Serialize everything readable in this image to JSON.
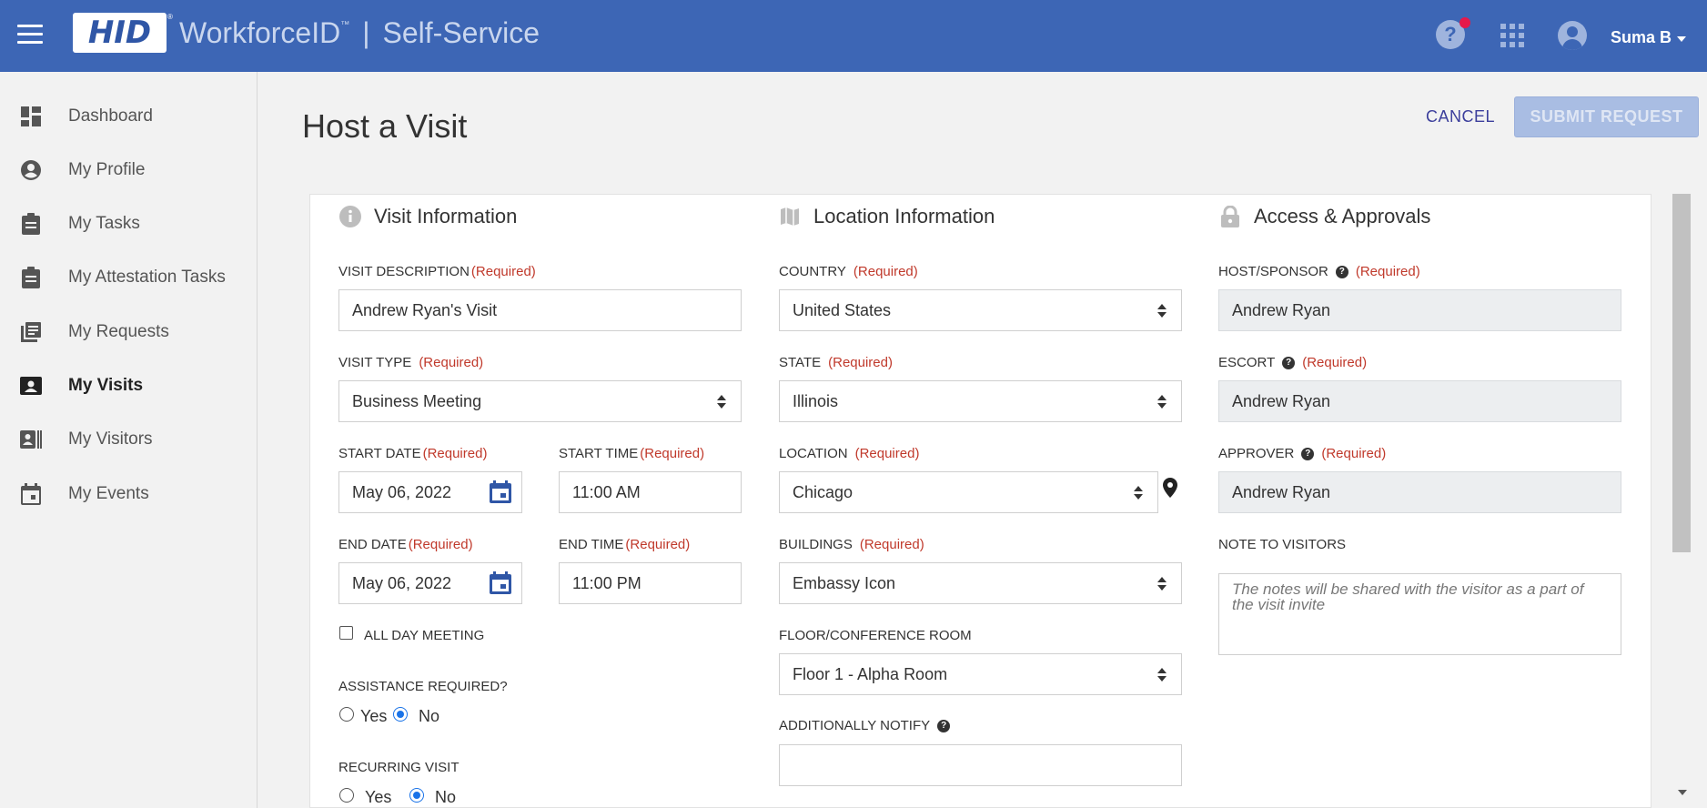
{
  "header": {
    "logo_text": "HID",
    "logo_reg": "®",
    "product": "WorkforceID",
    "tm": "™",
    "divider": "|",
    "app": "Self-Service",
    "user_name": "Suma B",
    "icons": [
      "menu-icon",
      "help-icon",
      "apps-grid-icon",
      "user-avatar-icon"
    ],
    "colors": {
      "bar": "#3d66b5",
      "notification": "#e5194b"
    }
  },
  "sidebar": {
    "items": [
      {
        "label": "Dashboard",
        "icon": "dashboard-icon"
      },
      {
        "label": "My Profile",
        "icon": "profile-icon"
      },
      {
        "label": "My Tasks",
        "icon": "clipboard-icon"
      },
      {
        "label": "My Attestation Tasks",
        "icon": "clipboard-icon"
      },
      {
        "label": "My Requests",
        "icon": "requests-icon"
      },
      {
        "label": "My Visits",
        "icon": "visit-badge-icon",
        "active": true
      },
      {
        "label": "My Visitors",
        "icon": "visitors-icon"
      },
      {
        "label": "My Events",
        "icon": "calendar-icon"
      }
    ]
  },
  "page": {
    "title": "Host a Visit",
    "cancel": "CANCEL",
    "submit": "SUBMIT REQUEST"
  },
  "required_text": "(Required)",
  "visit": {
    "heading": "Visit Information",
    "description_label": "VISIT DESCRIPTION",
    "description_value": "Andrew Ryan's Visit",
    "type_label": "VISIT TYPE",
    "type_value": "Business Meeting",
    "start_date_label": "START DATE",
    "start_date_value": "May 06, 2022",
    "start_time_label": "START TIME",
    "start_time_value": "11:00 AM",
    "end_date_label": "END DATE",
    "end_date_value": "May 06, 2022",
    "end_time_label": "END TIME",
    "end_time_value": "11:00 PM",
    "all_day_label": "ALL DAY MEETING",
    "all_day_checked": false,
    "assistance_label": "ASSISTANCE REQUIRED?",
    "assistance_value": "No",
    "recurring_label": "RECURRING VISIT",
    "recurring_value": "No",
    "yes": "Yes",
    "no": "No"
  },
  "location": {
    "heading": "Location Information",
    "country_label": "COUNTRY",
    "country_value": "United States",
    "state_label": "STATE",
    "state_value": "Illinois",
    "location_label": "LOCATION",
    "location_value": "Chicago",
    "buildings_label": "BUILDINGS",
    "buildings_value": "Embassy Icon",
    "floor_label": "FLOOR/CONFERENCE ROOM",
    "floor_value": "Floor 1 - Alpha Room",
    "notify_label": "ADDITIONALLY NOTIFY",
    "notify_value": ""
  },
  "access": {
    "heading": "Access & Approvals",
    "host_label": "HOST/SPONSOR",
    "host_value": "Andrew Ryan",
    "escort_label": "ESCORT",
    "escort_value": "Andrew Ryan",
    "approver_label": "APPROVER",
    "approver_value": "Andrew Ryan",
    "note_label": "NOTE TO VISITORS",
    "note_placeholder": "The notes will be shared with the visitor as a part of the visit invite"
  },
  "help_glyph": "?"
}
